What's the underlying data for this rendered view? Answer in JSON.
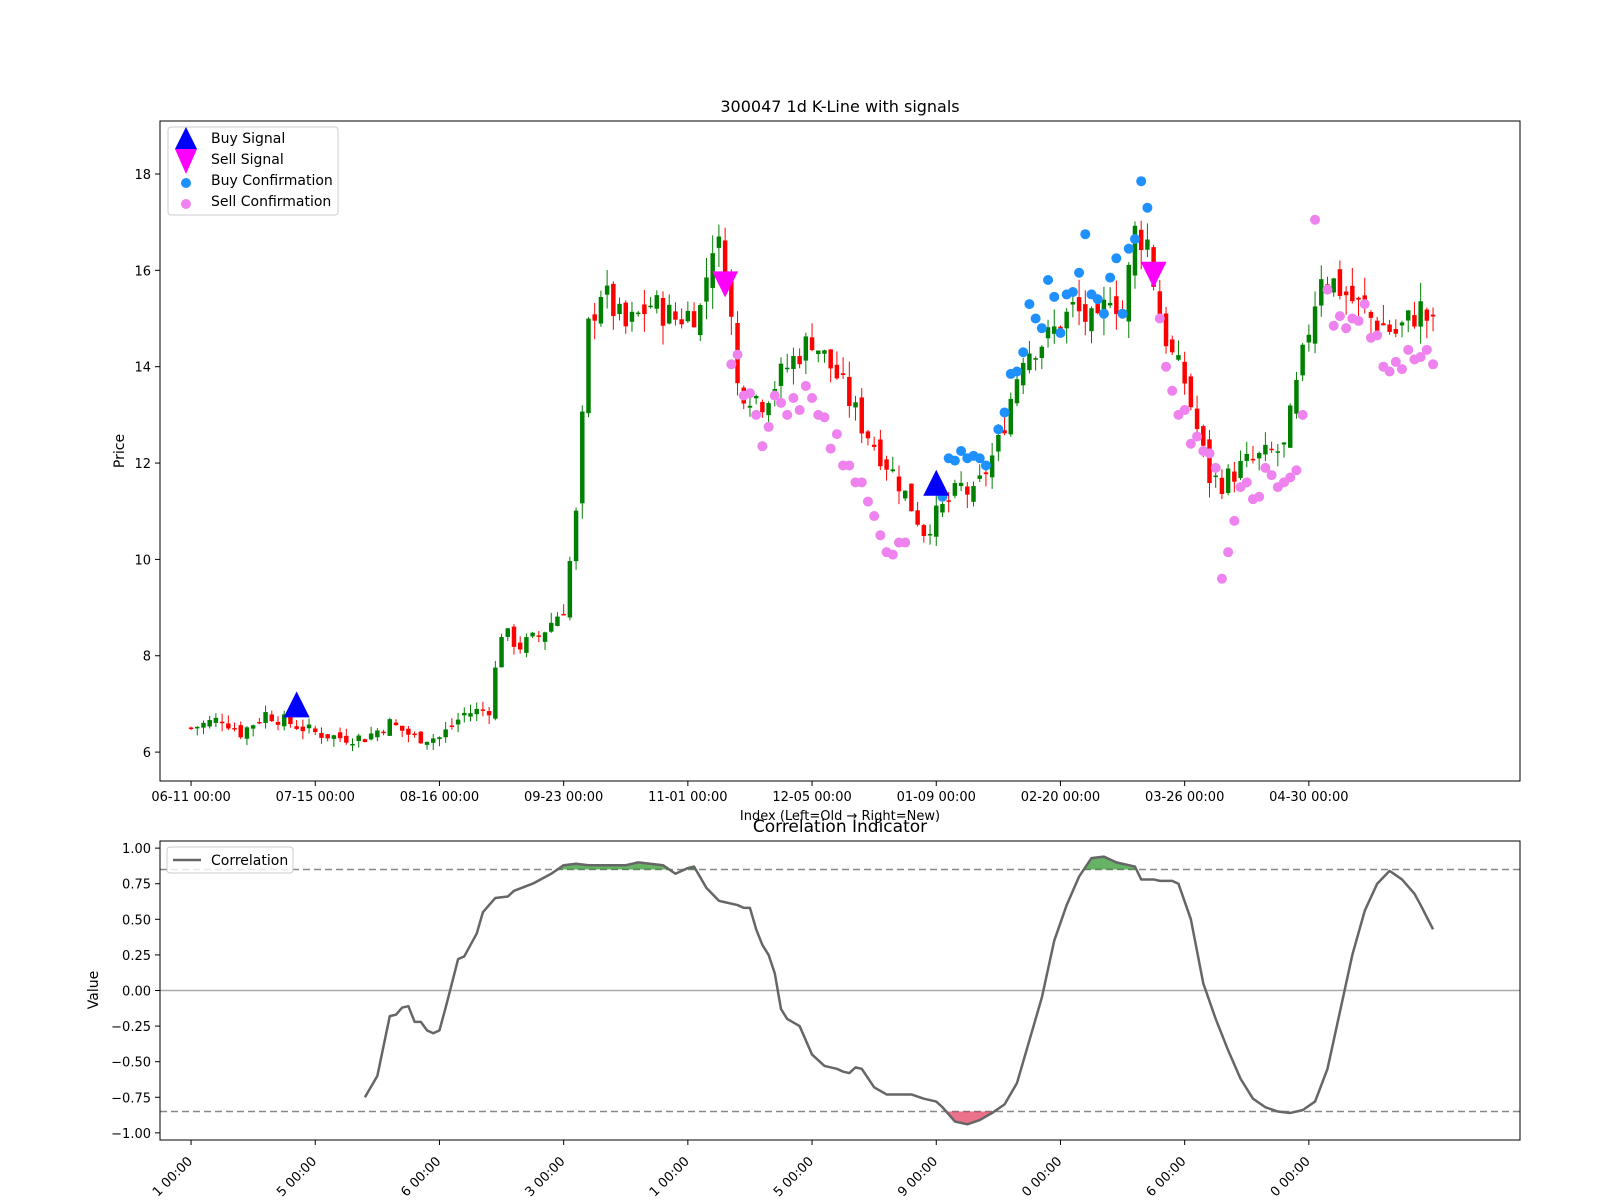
{
  "chart_data": [
    {
      "type": "candlestick",
      "title": "300047 1d K-Line with signals",
      "xlabel": "Index (Left=Old → Right=New)",
      "ylabel": "Price",
      "xlim": [
        -5,
        214
      ],
      "ylim": [
        5.4,
        19.1
      ],
      "grid": false,
      "legend_position": "top-left",
      "x_ticks": [
        {
          "index": 0,
          "label": "06-11 00:00"
        },
        {
          "index": 20,
          "label": "07-15 00:00"
        },
        {
          "index": 40,
          "label": "08-16 00:00"
        },
        {
          "index": 60,
          "label": "09-23 00:00"
        },
        {
          "index": 80,
          "label": "11-01 00:00"
        },
        {
          "index": 100,
          "label": "12-05 00:00"
        },
        {
          "index": 120,
          "label": "01-09 00:00"
        },
        {
          "index": 140,
          "label": "02-20 00:00"
        },
        {
          "index": 160,
          "label": "03-26 00:00"
        },
        {
          "index": 180,
          "label": "04-30 00:00"
        }
      ],
      "y_ticks": [
        6,
        8,
        10,
        12,
        14,
        16,
        18
      ],
      "legend": {
        "buy_signal": "Buy Signal",
        "sell_signal": "Sell Signal",
        "buy_confirmation": "Buy Confirmation",
        "sell_confirmation": "Sell Confirmation"
      },
      "colors": {
        "up": "#008000",
        "down": "#ff0000",
        "buy_signal": "#0000ff",
        "sell_signal": "#ff00ff",
        "buy_confirmation": "#1e90ff",
        "sell_confirmation": "#ee82ee"
      },
      "close_waypoints": [
        [
          0,
          6.5
        ],
        [
          5,
          6.7
        ],
        [
          8,
          6.4
        ],
        [
          12,
          6.8
        ],
        [
          16,
          6.6
        ],
        [
          20,
          6.4
        ],
        [
          24,
          6.3
        ],
        [
          28,
          6.3
        ],
        [
          32,
          6.6
        ],
        [
          36,
          6.3
        ],
        [
          40,
          6.3
        ],
        [
          44,
          6.8
        ],
        [
          48,
          6.9
        ],
        [
          50,
          8.5
        ],
        [
          53,
          8.2
        ],
        [
          56,
          8.4
        ],
        [
          60,
          9.0
        ],
        [
          62,
          10.9
        ],
        [
          64,
          14.8
        ],
        [
          66,
          15.6
        ],
        [
          70,
          14.8
        ],
        [
          74,
          15.3
        ],
        [
          78,
          15.0
        ],
        [
          82,
          15.2
        ],
        [
          84,
          16.6
        ],
        [
          86,
          16.3
        ],
        [
          88,
          13.6
        ],
        [
          92,
          13.3
        ],
        [
          96,
          14.0
        ],
        [
          100,
          14.6
        ],
        [
          104,
          13.8
        ],
        [
          108,
          12.8
        ],
        [
          112,
          12.0
        ],
        [
          114,
          11.6
        ],
        [
          118,
          10.6
        ],
        [
          120,
          10.9
        ],
        [
          124,
          11.5
        ],
        [
          126,
          11.3
        ],
        [
          130,
          12.4
        ],
        [
          134,
          14.3
        ],
        [
          138,
          14.6
        ],
        [
          142,
          15.2
        ],
        [
          146,
          14.8
        ],
        [
          148,
          15.6
        ],
        [
          150,
          15.1
        ],
        [
          152,
          16.8
        ],
        [
          154,
          16.6
        ],
        [
          156,
          15.0
        ],
        [
          158,
          14.2
        ],
        [
          160,
          13.7
        ],
        [
          162,
          12.7
        ],
        [
          164,
          11.7
        ],
        [
          166,
          11.6
        ],
        [
          170,
          12.0
        ],
        [
          174,
          12.2
        ],
        [
          176,
          12.3
        ],
        [
          180,
          14.8
        ],
        [
          182,
          16.0
        ],
        [
          186,
          15.5
        ],
        [
          190,
          15.0
        ],
        [
          194,
          14.7
        ],
        [
          198,
          15.2
        ],
        [
          200,
          14.8
        ]
      ],
      "buy_signals": [
        {
          "index": 17,
          "price": 6.95
        },
        {
          "index": 120,
          "price": 11.55
        }
      ],
      "sell_signals": [
        {
          "index": 86,
          "price": 15.75
        },
        {
          "index": 155,
          "price": 15.95
        }
      ],
      "buy_confirmations": [
        [
          121,
          11.3
        ],
        [
          122,
          12.1
        ],
        [
          123,
          12.05
        ],
        [
          124,
          12.25
        ],
        [
          125,
          12.1
        ],
        [
          126,
          12.15
        ],
        [
          127,
          12.1
        ],
        [
          128,
          11.95
        ],
        [
          130,
          12.7
        ],
        [
          131,
          13.05
        ],
        [
          132,
          13.85
        ],
        [
          133,
          13.9
        ],
        [
          134,
          14.3
        ],
        [
          135,
          15.3
        ],
        [
          136,
          15.0
        ],
        [
          137,
          14.8
        ],
        [
          138,
          15.8
        ],
        [
          139,
          15.45
        ],
        [
          140,
          14.7
        ],
        [
          141,
          15.5
        ],
        [
          142,
          15.55
        ],
        [
          143,
          15.95
        ],
        [
          144,
          16.75
        ],
        [
          145,
          15.5
        ],
        [
          146,
          15.4
        ],
        [
          147,
          15.1
        ],
        [
          148,
          15.85
        ],
        [
          149,
          16.25
        ],
        [
          150,
          15.1
        ],
        [
          151,
          16.45
        ],
        [
          152,
          16.65
        ],
        [
          153,
          17.85
        ],
        [
          154,
          17.3
        ]
      ],
      "sell_confirmations": [
        [
          87,
          14.05
        ],
        [
          88,
          14.25
        ],
        [
          89,
          13.4
        ],
        [
          90,
          13.45
        ],
        [
          91,
          13.0
        ],
        [
          92,
          12.35
        ],
        [
          93,
          12.75
        ],
        [
          94,
          13.4
        ],
        [
          95,
          13.25
        ],
        [
          96,
          13.0
        ],
        [
          97,
          13.35
        ],
        [
          98,
          13.1
        ],
        [
          99,
          13.6
        ],
        [
          100,
          13.35
        ],
        [
          101,
          13.0
        ],
        [
          102,
          12.95
        ],
        [
          103,
          12.3
        ],
        [
          104,
          12.6
        ],
        [
          105,
          11.95
        ],
        [
          106,
          11.95
        ],
        [
          107,
          11.6
        ],
        [
          108,
          11.6
        ],
        [
          109,
          11.2
        ],
        [
          110,
          10.9
        ],
        [
          111,
          10.5
        ],
        [
          112,
          10.15
        ],
        [
          113,
          10.1
        ],
        [
          114,
          10.35
        ],
        [
          115,
          10.35
        ],
        [
          156,
          15.0
        ],
        [
          157,
          14.0
        ],
        [
          158,
          13.5
        ],
        [
          159,
          13.0
        ],
        [
          160,
          13.1
        ],
        [
          161,
          12.4
        ],
        [
          162,
          12.55
        ],
        [
          163,
          12.25
        ],
        [
          164,
          12.2
        ],
        [
          165,
          11.9
        ],
        [
          166,
          9.6
        ],
        [
          167,
          10.15
        ],
        [
          168,
          10.8
        ],
        [
          169,
          11.5
        ],
        [
          170,
          11.6
        ],
        [
          171,
          11.25
        ],
        [
          172,
          11.3
        ],
        [
          173,
          11.9
        ],
        [
          174,
          11.75
        ],
        [
          175,
          11.5
        ],
        [
          176,
          11.6
        ],
        [
          177,
          11.7
        ],
        [
          178,
          11.85
        ],
        [
          179,
          13.0
        ],
        [
          181,
          17.05
        ],
        [
          183,
          15.6
        ],
        [
          184,
          14.85
        ],
        [
          185,
          15.05
        ],
        [
          186,
          14.8
        ],
        [
          187,
          15.0
        ],
        [
          188,
          14.95
        ],
        [
          189,
          15.3
        ],
        [
          190,
          14.6
        ],
        [
          191,
          14.65
        ],
        [
          192,
          14.0
        ],
        [
          193,
          13.9
        ],
        [
          194,
          14.1
        ],
        [
          195,
          13.95
        ],
        [
          196,
          14.35
        ],
        [
          197,
          14.15
        ],
        [
          198,
          14.2
        ],
        [
          199,
          14.35
        ],
        [
          200,
          14.05
        ]
      ]
    },
    {
      "type": "line",
      "title": "Correlation Indicator",
      "xlabel": "",
      "ylabel": "Value",
      "xlim": [
        -5,
        214
      ],
      "ylim": [
        -1.05,
        1.05
      ],
      "y_ticks": [
        "1.00",
        "0.75",
        "0.50",
        "0.25",
        "0.00",
        "−0.25",
        "−0.50",
        "−0.75",
        "−1.00"
      ],
      "x_tick_indices": [
        0,
        20,
        40,
        60,
        80,
        100,
        120,
        140,
        160,
        180
      ],
      "x_tick_labels": [
        "1 00:00",
        "5 00:00",
        "6 00:00",
        "3 00:00",
        "1 00:00",
        "5 00:00",
        "9 00:00",
        "0 00:00",
        "6 00:00",
        "0 00:00"
      ],
      "upper_threshold": 0.85,
      "lower_threshold": -0.85,
      "legend_position": "top-left",
      "series": [
        {
          "name": "Correlation",
          "color": "#666666",
          "points": [
            [
              28,
              -0.75
            ],
            [
              30,
              -0.6
            ],
            [
              32,
              -0.18
            ],
            [
              33,
              -0.17
            ],
            [
              34,
              -0.12
            ],
            [
              35,
              -0.11
            ],
            [
              36,
              -0.22
            ],
            [
              37,
              -0.22
            ],
            [
              38,
              -0.28
            ],
            [
              39,
              -0.3
            ],
            [
              40,
              -0.28
            ],
            [
              41,
              -0.12
            ],
            [
              42,
              0.05
            ],
            [
              43,
              0.22
            ],
            [
              44,
              0.24
            ],
            [
              46,
              0.4
            ],
            [
              47,
              0.55
            ],
            [
              49,
              0.65
            ],
            [
              51,
              0.66
            ],
            [
              52,
              0.7
            ],
            [
              55,
              0.75
            ],
            [
              58,
              0.82
            ],
            [
              60,
              0.88
            ],
            [
              62,
              0.89
            ],
            [
              64,
              0.88
            ],
            [
              70,
              0.88
            ],
            [
              72,
              0.9
            ],
            [
              76,
              0.88
            ],
            [
              78,
              0.82
            ],
            [
              80,
              0.86
            ],
            [
              81,
              0.87
            ],
            [
              83,
              0.72
            ],
            [
              85,
              0.63
            ],
            [
              86,
              0.62
            ],
            [
              88,
              0.6
            ],
            [
              89,
              0.58
            ],
            [
              90,
              0.58
            ],
            [
              91,
              0.43
            ],
            [
              92,
              0.32
            ],
            [
              93,
              0.25
            ],
            [
              94,
              0.12
            ],
            [
              95,
              -0.13
            ],
            [
              96,
              -0.2
            ],
            [
              98,
              -0.25
            ],
            [
              99,
              -0.35
            ],
            [
              100,
              -0.45
            ],
            [
              102,
              -0.53
            ],
            [
              104,
              -0.55
            ],
            [
              105,
              -0.57
            ],
            [
              106,
              -0.58
            ],
            [
              107,
              -0.54
            ],
            [
              108,
              -0.55
            ],
            [
              110,
              -0.68
            ],
            [
              112,
              -0.73
            ],
            [
              114,
              -0.73
            ],
            [
              116,
              -0.73
            ],
            [
              118,
              -0.76
            ],
            [
              120,
              -0.78
            ],
            [
              121,
              -0.82
            ],
            [
              123,
              -0.92
            ],
            [
              125,
              -0.94
            ],
            [
              127,
              -0.91
            ],
            [
              129,
              -0.86
            ],
            [
              131,
              -0.8
            ],
            [
              133,
              -0.65
            ],
            [
              135,
              -0.35
            ],
            [
              137,
              -0.05
            ],
            [
              139,
              0.35
            ],
            [
              141,
              0.6
            ],
            [
              143,
              0.8
            ],
            [
              145,
              0.93
            ],
            [
              147,
              0.94
            ],
            [
              149,
              0.9
            ],
            [
              151,
              0.88
            ],
            [
              152,
              0.87
            ],
            [
              153,
              0.78
            ],
            [
              155,
              0.78
            ],
            [
              156,
              0.77
            ],
            [
              158,
              0.77
            ],
            [
              159,
              0.75
            ],
            [
              161,
              0.5
            ],
            [
              163,
              0.05
            ],
            [
              165,
              -0.2
            ],
            [
              167,
              -0.42
            ],
            [
              169,
              -0.62
            ],
            [
              171,
              -0.76
            ],
            [
              173,
              -0.82
            ],
            [
              175,
              -0.85
            ],
            [
              177,
              -0.86
            ],
            [
              179,
              -0.84
            ],
            [
              181,
              -0.78
            ],
            [
              183,
              -0.55
            ],
            [
              185,
              -0.15
            ],
            [
              187,
              0.25
            ],
            [
              189,
              0.56
            ],
            [
              191,
              0.75
            ],
            [
              193,
              0.84
            ],
            [
              195,
              0.78
            ],
            [
              197,
              0.68
            ],
            [
              198,
              0.6
            ],
            [
              200,
              0.43
            ]
          ]
        }
      ]
    }
  ]
}
